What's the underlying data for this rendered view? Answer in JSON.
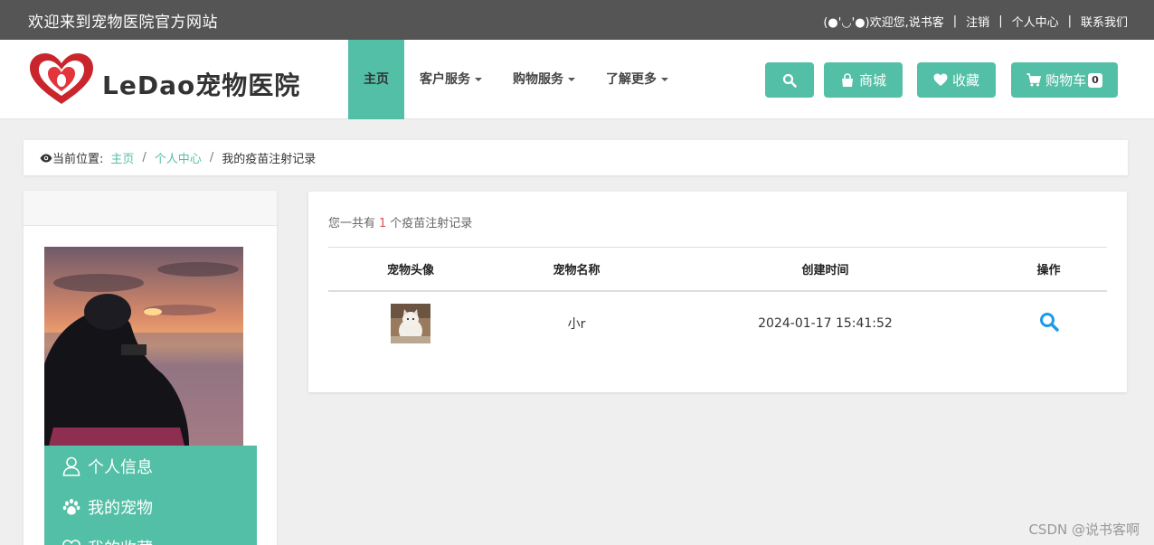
{
  "topbar": {
    "welcome": "欢迎来到宠物医院官方网站",
    "user_greeting": "(●'◡'●)欢迎您,说书客",
    "logout": "注销",
    "profile": "个人中心",
    "contact": "联系我们"
  },
  "header": {
    "brand": "LeDao宠物医院",
    "nav": {
      "home": "主页",
      "customer_service": "客户服务",
      "shopping_service": "购物服务",
      "learn_more": "了解更多"
    },
    "buttons": {
      "mall": "商城",
      "favorites": "收藏",
      "cart": "购物车",
      "cart_count": "0"
    },
    "colors": {
      "accent": "#53bfa6",
      "topbar": "#555555"
    }
  },
  "breadcrumb": {
    "label": "当前位置:",
    "home": "主页",
    "profile": "个人中心",
    "current": "我的疫苗注射记录"
  },
  "sidebar": {
    "menu": {
      "personal_info": "个人信息",
      "my_pets": "我的宠物",
      "my_favorites": "我的收藏"
    }
  },
  "records": {
    "summary_prefix": "您一共有",
    "count": "1",
    "summary_suffix": "个疫苗注射记录",
    "columns": {
      "avatar": "宠物头像",
      "name": "宠物名称",
      "created": "创建时间",
      "actions": "操作"
    },
    "rows": [
      {
        "name": "小r",
        "created": "2024-01-17 15:41:52"
      }
    ]
  },
  "watermark": "CSDN @说书客啊"
}
